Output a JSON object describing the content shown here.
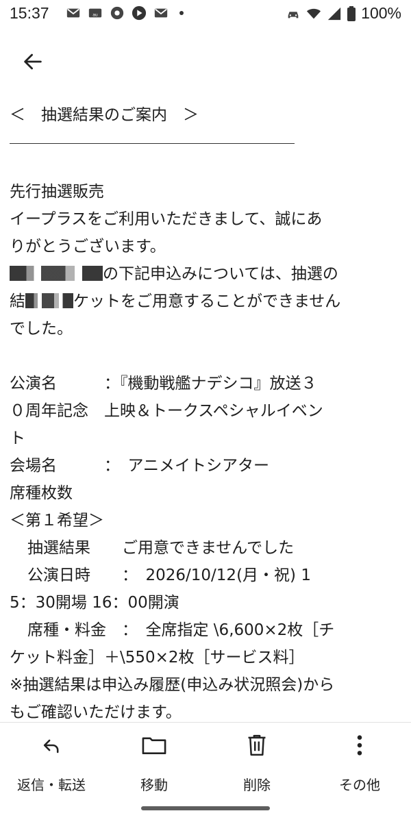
{
  "status_bar": {
    "time": "15:37",
    "battery": "100%",
    "left_icons": [
      "mail-icon",
      "au-mail-icon",
      "app-icon",
      "play-icon",
      "mail-icon",
      "dot-icon"
    ],
    "right_icons": [
      "car-icon",
      "wifi-icon",
      "signal-icon",
      "battery-icon"
    ]
  },
  "email": {
    "subject": "＜　抽選結果のご案内　＞",
    "intro_lines": [
      "先行抽選販売",
      "イープラスをご利用いただきまして、誠にあ",
      "りがとうございます。"
    ],
    "notice_line_1_suffix": "の下記申込みについては、抽選の",
    "notice_line_2_prefix": "結",
    "notice_line_2_suffix": "ケットをご用意することができません",
    "notice_line_3": "でした。",
    "details": {
      "performance_line_1": "公演名　　　：『機動戦艦ナデシコ』放送３",
      "performance_line_2": "０周年記念　上映＆トークスペシャルイベン",
      "performance_line_3": "ト",
      "venue": "会場名　　　：　アニメイトシアター",
      "seat_count": "席種枚数",
      "choice": "＜第１希望＞",
      "result": "抽選結果　　ご用意できませんでした",
      "date_line_1": "公演日時　　：　2026/10/12(月・祝) 1",
      "date_line_2": "5：30開場 16：00開演",
      "price_line_1": "席種・料金　：　全席指定 \\6,600×2枚［チ",
      "price_line_2": "ケット料金］＋\\550×2枚［サービス料］",
      "note_line_1": "※抽選結果は申込み履歴(申込み状況照会)から",
      "note_line_2": "もご確認いただけます。"
    }
  },
  "actions": [
    {
      "label": "返信・転送",
      "icon": "reply-icon"
    },
    {
      "label": "移動",
      "icon": "folder-icon"
    },
    {
      "label": "削除",
      "icon": "trash-icon"
    },
    {
      "label": "その他",
      "icon": "more-vert-icon"
    }
  ]
}
